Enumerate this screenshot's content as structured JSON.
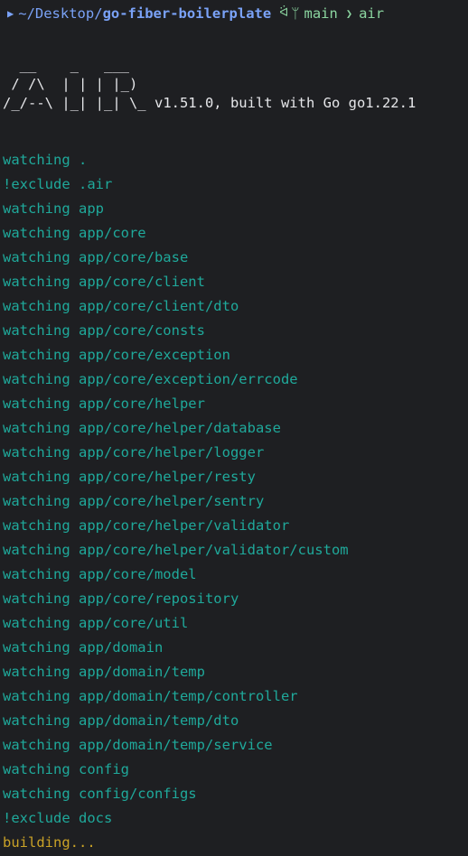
{
  "prompt": {
    "apple_icon": "",
    "folder_icon": "▶",
    "path_prefix": "~/Desktop/",
    "path_repo": "go-fiber-boilerplate",
    "github_icon": "ᐛ",
    "branch_icon": "ᛘ",
    "branch": "main",
    "arrow": "❯",
    "command": "air"
  },
  "banner": {
    "line1": "  __    _   ___",
    "line2": " / /\\  | | | |_)",
    "line3_art": "/_/--\\ |_| |_| \\_ ",
    "line3_version": "v1.51.0, built with Go go1.22.1"
  },
  "log_lines": [
    {
      "text": "watching .",
      "kind": "watch"
    },
    {
      "text": "!exclude .air",
      "kind": "watch"
    },
    {
      "text": "watching app",
      "kind": "watch"
    },
    {
      "text": "watching app/core",
      "kind": "watch"
    },
    {
      "text": "watching app/core/base",
      "kind": "watch"
    },
    {
      "text": "watching app/core/client",
      "kind": "watch"
    },
    {
      "text": "watching app/core/client/dto",
      "kind": "watch"
    },
    {
      "text": "watching app/core/consts",
      "kind": "watch"
    },
    {
      "text": "watching app/core/exception",
      "kind": "watch"
    },
    {
      "text": "watching app/core/exception/errcode",
      "kind": "watch"
    },
    {
      "text": "watching app/core/helper",
      "kind": "watch"
    },
    {
      "text": "watching app/core/helper/database",
      "kind": "watch"
    },
    {
      "text": "watching app/core/helper/logger",
      "kind": "watch"
    },
    {
      "text": "watching app/core/helper/resty",
      "kind": "watch"
    },
    {
      "text": "watching app/core/helper/sentry",
      "kind": "watch"
    },
    {
      "text": "watching app/core/helper/validator",
      "kind": "watch"
    },
    {
      "text": "watching app/core/helper/validator/custom",
      "kind": "watch"
    },
    {
      "text": "watching app/core/model",
      "kind": "watch"
    },
    {
      "text": "watching app/core/repository",
      "kind": "watch"
    },
    {
      "text": "watching app/core/util",
      "kind": "watch"
    },
    {
      "text": "watching app/domain",
      "kind": "watch"
    },
    {
      "text": "watching app/domain/temp",
      "kind": "watch"
    },
    {
      "text": "watching app/domain/temp/controller",
      "kind": "watch"
    },
    {
      "text": "watching app/domain/temp/dto",
      "kind": "watch"
    },
    {
      "text": "watching app/domain/temp/service",
      "kind": "watch"
    },
    {
      "text": "watching config",
      "kind": "watch"
    },
    {
      "text": "watching config/configs",
      "kind": "watch"
    },
    {
      "text": "!exclude docs",
      "kind": "watch"
    },
    {
      "text": "building...",
      "kind": "building"
    }
  ],
  "colors": {
    "background": "#1e1f22",
    "watch_text": "#1fa99b",
    "building_text": "#c9a227",
    "path": "#7aa2f7",
    "git": "#8bd5a0"
  }
}
